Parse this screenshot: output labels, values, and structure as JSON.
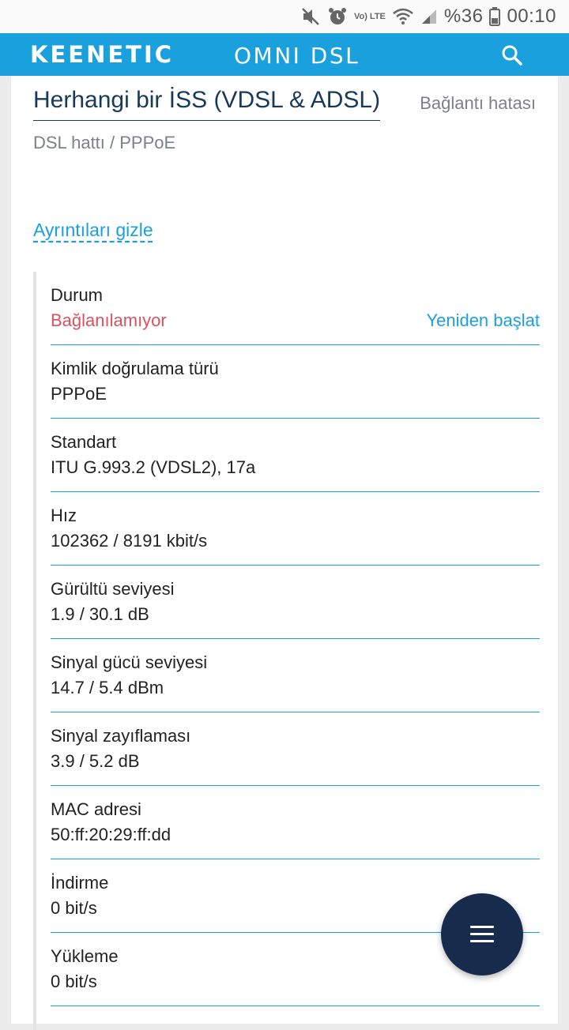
{
  "status_bar": {
    "battery_percent": "%36",
    "time": "00:10",
    "volte_label": "Vo) LTE"
  },
  "app_bar": {
    "brand": "KEENETIC",
    "model": "OMNI DSL",
    "brand_color": "#1aa0dd"
  },
  "connection": {
    "title": "Herhangi bir İSS (VDSL & ADSL)",
    "status": "Bağlantı hatası",
    "subtitle": "DSL hattı / PPPoE",
    "toggle_details": "Ayrıntıları gizle"
  },
  "details": [
    {
      "label": "Durum",
      "value": "Bağlanılamıyor",
      "action": "Yeniden başlat"
    },
    {
      "label": "Kimlik doğrulama türü",
      "value": "PPPoE"
    },
    {
      "label": "Standart",
      "value": "ITU G.993.2 (VDSL2), 17a"
    },
    {
      "label": "Hız",
      "value": "102362 / 8191 kbit/s"
    },
    {
      "label": "Gürültü seviyesi",
      "value": "1.9 / 30.1 dB"
    },
    {
      "label": "Sinyal gücü seviyesi",
      "value": "14.7 / 5.4 dBm"
    },
    {
      "label": "Sinyal zayıflaması",
      "value": "3.9 / 5.2 dB"
    },
    {
      "label": "MAC adresi",
      "value": "50:ff:20:29:ff:dd"
    },
    {
      "label": "İndirme",
      "value": "0 bit/s"
    },
    {
      "label": "Yükleme",
      "value": "0 bit/s"
    }
  ],
  "colors": {
    "error": "#d9535f",
    "accent": "#1aa0dd",
    "fab": "#172b4d"
  },
  "icons": {
    "search": "search-icon",
    "menu": "menu-icon"
  }
}
